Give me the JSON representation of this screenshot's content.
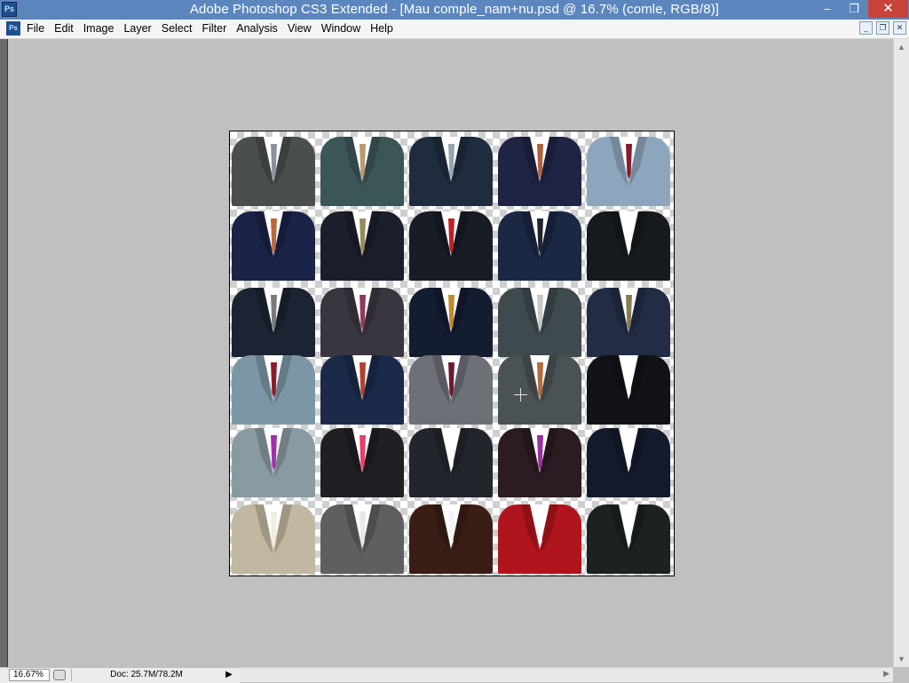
{
  "window": {
    "title": "Adobe Photoshop CS3 Extended - [Mau comple_nam+nu.psd @ 16.7% (comle, RGB/8)]",
    "app_icon": "Ps",
    "minimize": "–",
    "maximize": "❐",
    "close": "✕"
  },
  "menu": {
    "doc_icon": "Ps",
    "items": [
      "File",
      "Edit",
      "Image",
      "Layer",
      "Select",
      "Filter",
      "Analysis",
      "View",
      "Window",
      "Help"
    ],
    "mdi_minimize": "_",
    "mdi_restore": "❐",
    "mdi_close": "✕"
  },
  "status": {
    "zoom": "16.67%",
    "doc": "Doc: 25.7M/78.2M",
    "arrow": "▶"
  },
  "scroll": {
    "up": "▲",
    "down": "▼",
    "right": "▶"
  },
  "colors": {
    "titlebar": "#5b86be",
    "close_button": "#c7443a",
    "workspace": "#c0c0c0"
  },
  "canvas": {
    "content": "grid of cut-out business suit and blazer templates (6 rows × 5 columns) on transparent checkerboard background",
    "suits": [
      {
        "coat": "#4a4e4f",
        "tie": "#8a90a0"
      },
      {
        "coat": "#3c5658",
        "tie": "#b89a6e"
      },
      {
        "coat": "#1f2c3e",
        "tie": "#9aa3b0"
      },
      {
        "coat": "#1f2444",
        "tie": "#b0603a"
      },
      {
        "coat": "#8da6bd",
        "tie": "#8a1c2a"
      },
      {
        "coat": "#1a2348",
        "tie": "#b8693a"
      },
      {
        "coat": "#1b1f2c",
        "tie": "#9a8a5a"
      },
      {
        "coat": "#181c25",
        "tie": "#c21f25"
      },
      {
        "coat": "#1a2844",
        "tie": "#20252c"
      },
      {
        "coat": "#161a1e",
        "tie": "#ffffff"
      },
      {
        "coat": "#1c2433",
        "tie": "#7a7a7a"
      },
      {
        "coat": "#3a3640",
        "tie": "#8e3a5a"
      },
      {
        "coat": "#141c30",
        "tie": "#c08a2c"
      },
      {
        "coat": "#3f4a4f",
        "tie": "#c8c8c8"
      },
      {
        "coat": "#222d45",
        "tie": "#8a7a50"
      },
      {
        "coat": "#7c96a5",
        "tie": "#8a1c2a"
      },
      {
        "coat": "#1c2a4a",
        "tie": "#b04030"
      },
      {
        "coat": "#6e7078",
        "tie": "#6a1a30"
      },
      {
        "coat": "#4b5255",
        "tie": "#b46a3a"
      },
      {
        "coat": "#111318",
        "tie": "#ffffff"
      },
      {
        "coat": "#8a9aa2",
        "tie": "#a030b0"
      },
      {
        "coat": "#1f1f24",
        "tie": "#e8406a"
      },
      {
        "coat": "#22262c",
        "tie": "#ffffff"
      },
      {
        "coat": "#2a1c22",
        "tie": "#9a30a0"
      },
      {
        "coat": "#141a2c",
        "tie": "#ffffff"
      },
      {
        "coat": "#c2b8a2",
        "tie": "#f0ece0"
      },
      {
        "coat": "#5f5e60",
        "tie": "#e8e8e8"
      },
      {
        "coat": "#3a1e16",
        "tie": "#f5f5f5"
      },
      {
        "coat": "#b0141c",
        "tie": "#ffffff"
      },
      {
        "coat": "#1c2220",
        "tie": "#ffffff"
      }
    ]
  }
}
